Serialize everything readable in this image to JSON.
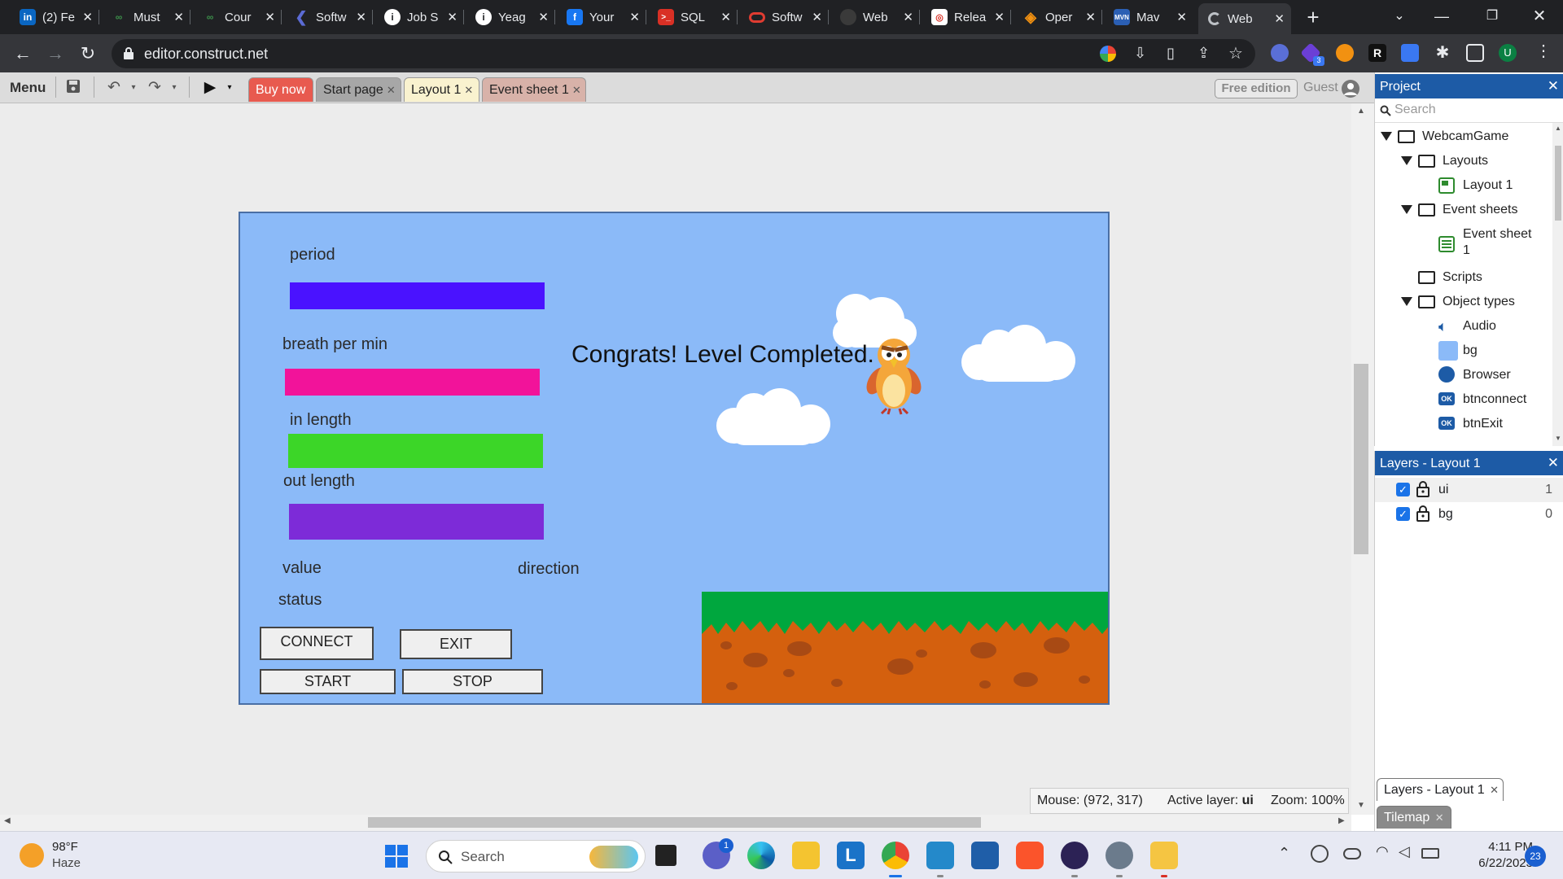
{
  "browser": {
    "tabs": [
      {
        "title": "(2) Fe",
        "icon": "linkedin-icon",
        "color": "#0a66c2"
      },
      {
        "title": "Must",
        "icon": "link-icon",
        "color": "#3c8f4a"
      },
      {
        "title": "Cour",
        "icon": "link-icon",
        "color": "#3c8f4a"
      },
      {
        "title": "Softw",
        "icon": "kotlin-icon",
        "color": "#5b6bd5"
      },
      {
        "title": "Job S",
        "icon": "info-icon",
        "color": "#ffffff"
      },
      {
        "title": "Yeag",
        "icon": "info-icon",
        "color": "#ffffff"
      },
      {
        "title": "Your",
        "icon": "facebook-icon",
        "color": "#1877f2"
      },
      {
        "title": "SQL",
        "icon": "terminal-icon",
        "color": "#d93025"
      },
      {
        "title": "Softw",
        "icon": "oracle-icon",
        "color": "#e03c31"
      },
      {
        "title": "Web",
        "icon": "github-icon",
        "color": "#3a3a3a"
      },
      {
        "title": "Relea",
        "icon": "release-icon",
        "color": "#ffffff"
      },
      {
        "title": "Oper",
        "icon": "diamond-icon",
        "color": "#f29111"
      },
      {
        "title": "Mav",
        "icon": "maven-icon",
        "color": "#2b5fb4"
      },
      {
        "title": "Web",
        "icon": "construct-icon",
        "color": "#bdc1c6"
      }
    ],
    "active_tab_index": 13,
    "url": "editor.construct.net",
    "profile_initial": "U",
    "extension_badge": "3"
  },
  "editor": {
    "menu_label": "Menu",
    "tabs": {
      "buy_now": "Buy now",
      "start_page": "Start page",
      "layout": "Layout 1",
      "event_sheet": "Event sheet 1"
    },
    "free_edition": "Free edition",
    "guest": "Guest"
  },
  "layout": {
    "labels": {
      "period": "period",
      "breath": "breath per min",
      "in_length": "in length",
      "out_length": "out length",
      "value": "value",
      "direction": "direction",
      "status": "status"
    },
    "bar_colors": {
      "period": "#4a12ff",
      "breath": "#f2139a",
      "in_length": "#3cd628",
      "out_length": "#7d2bd8"
    },
    "buttons": {
      "connect": "CONNECT",
      "exit": "EXIT",
      "start": "START",
      "stop": "STOP"
    },
    "message": "Congrats! Level Completed.",
    "background_color": "#8bbaf8"
  },
  "status": {
    "mouse_label": "Mouse:",
    "mouse_value": "(972, 317)",
    "active_layer_label": "Active layer:",
    "active_layer_value": "ui",
    "zoom_label": "Zoom:",
    "zoom_value": "100%"
  },
  "project": {
    "title": "Project",
    "search_placeholder": "Search",
    "root": "WebcamGame",
    "layouts": "Layouts",
    "layout_item": "Layout 1",
    "event_sheets": "Event sheets",
    "event_item_line1": "Event sheet",
    "event_item_line2": "1",
    "scripts": "Scripts",
    "object_types": "Object types",
    "objects": [
      "Audio",
      "bg",
      "Browser",
      "btnconnect",
      "btnExit"
    ]
  },
  "layers": {
    "title": "Layers - Layout 1",
    "rows": [
      {
        "name": "ui",
        "index": "1"
      },
      {
        "name": "bg",
        "index": "0"
      }
    ],
    "bottom_tabs": [
      "Layers - Layout 1",
      "Tilemap"
    ]
  },
  "taskbar": {
    "temperature": "98°F",
    "condition": "Haze",
    "search": "Search",
    "time": "4:11 PM",
    "date": "6/22/2023",
    "notifications": "23",
    "chat_badge": "1"
  }
}
